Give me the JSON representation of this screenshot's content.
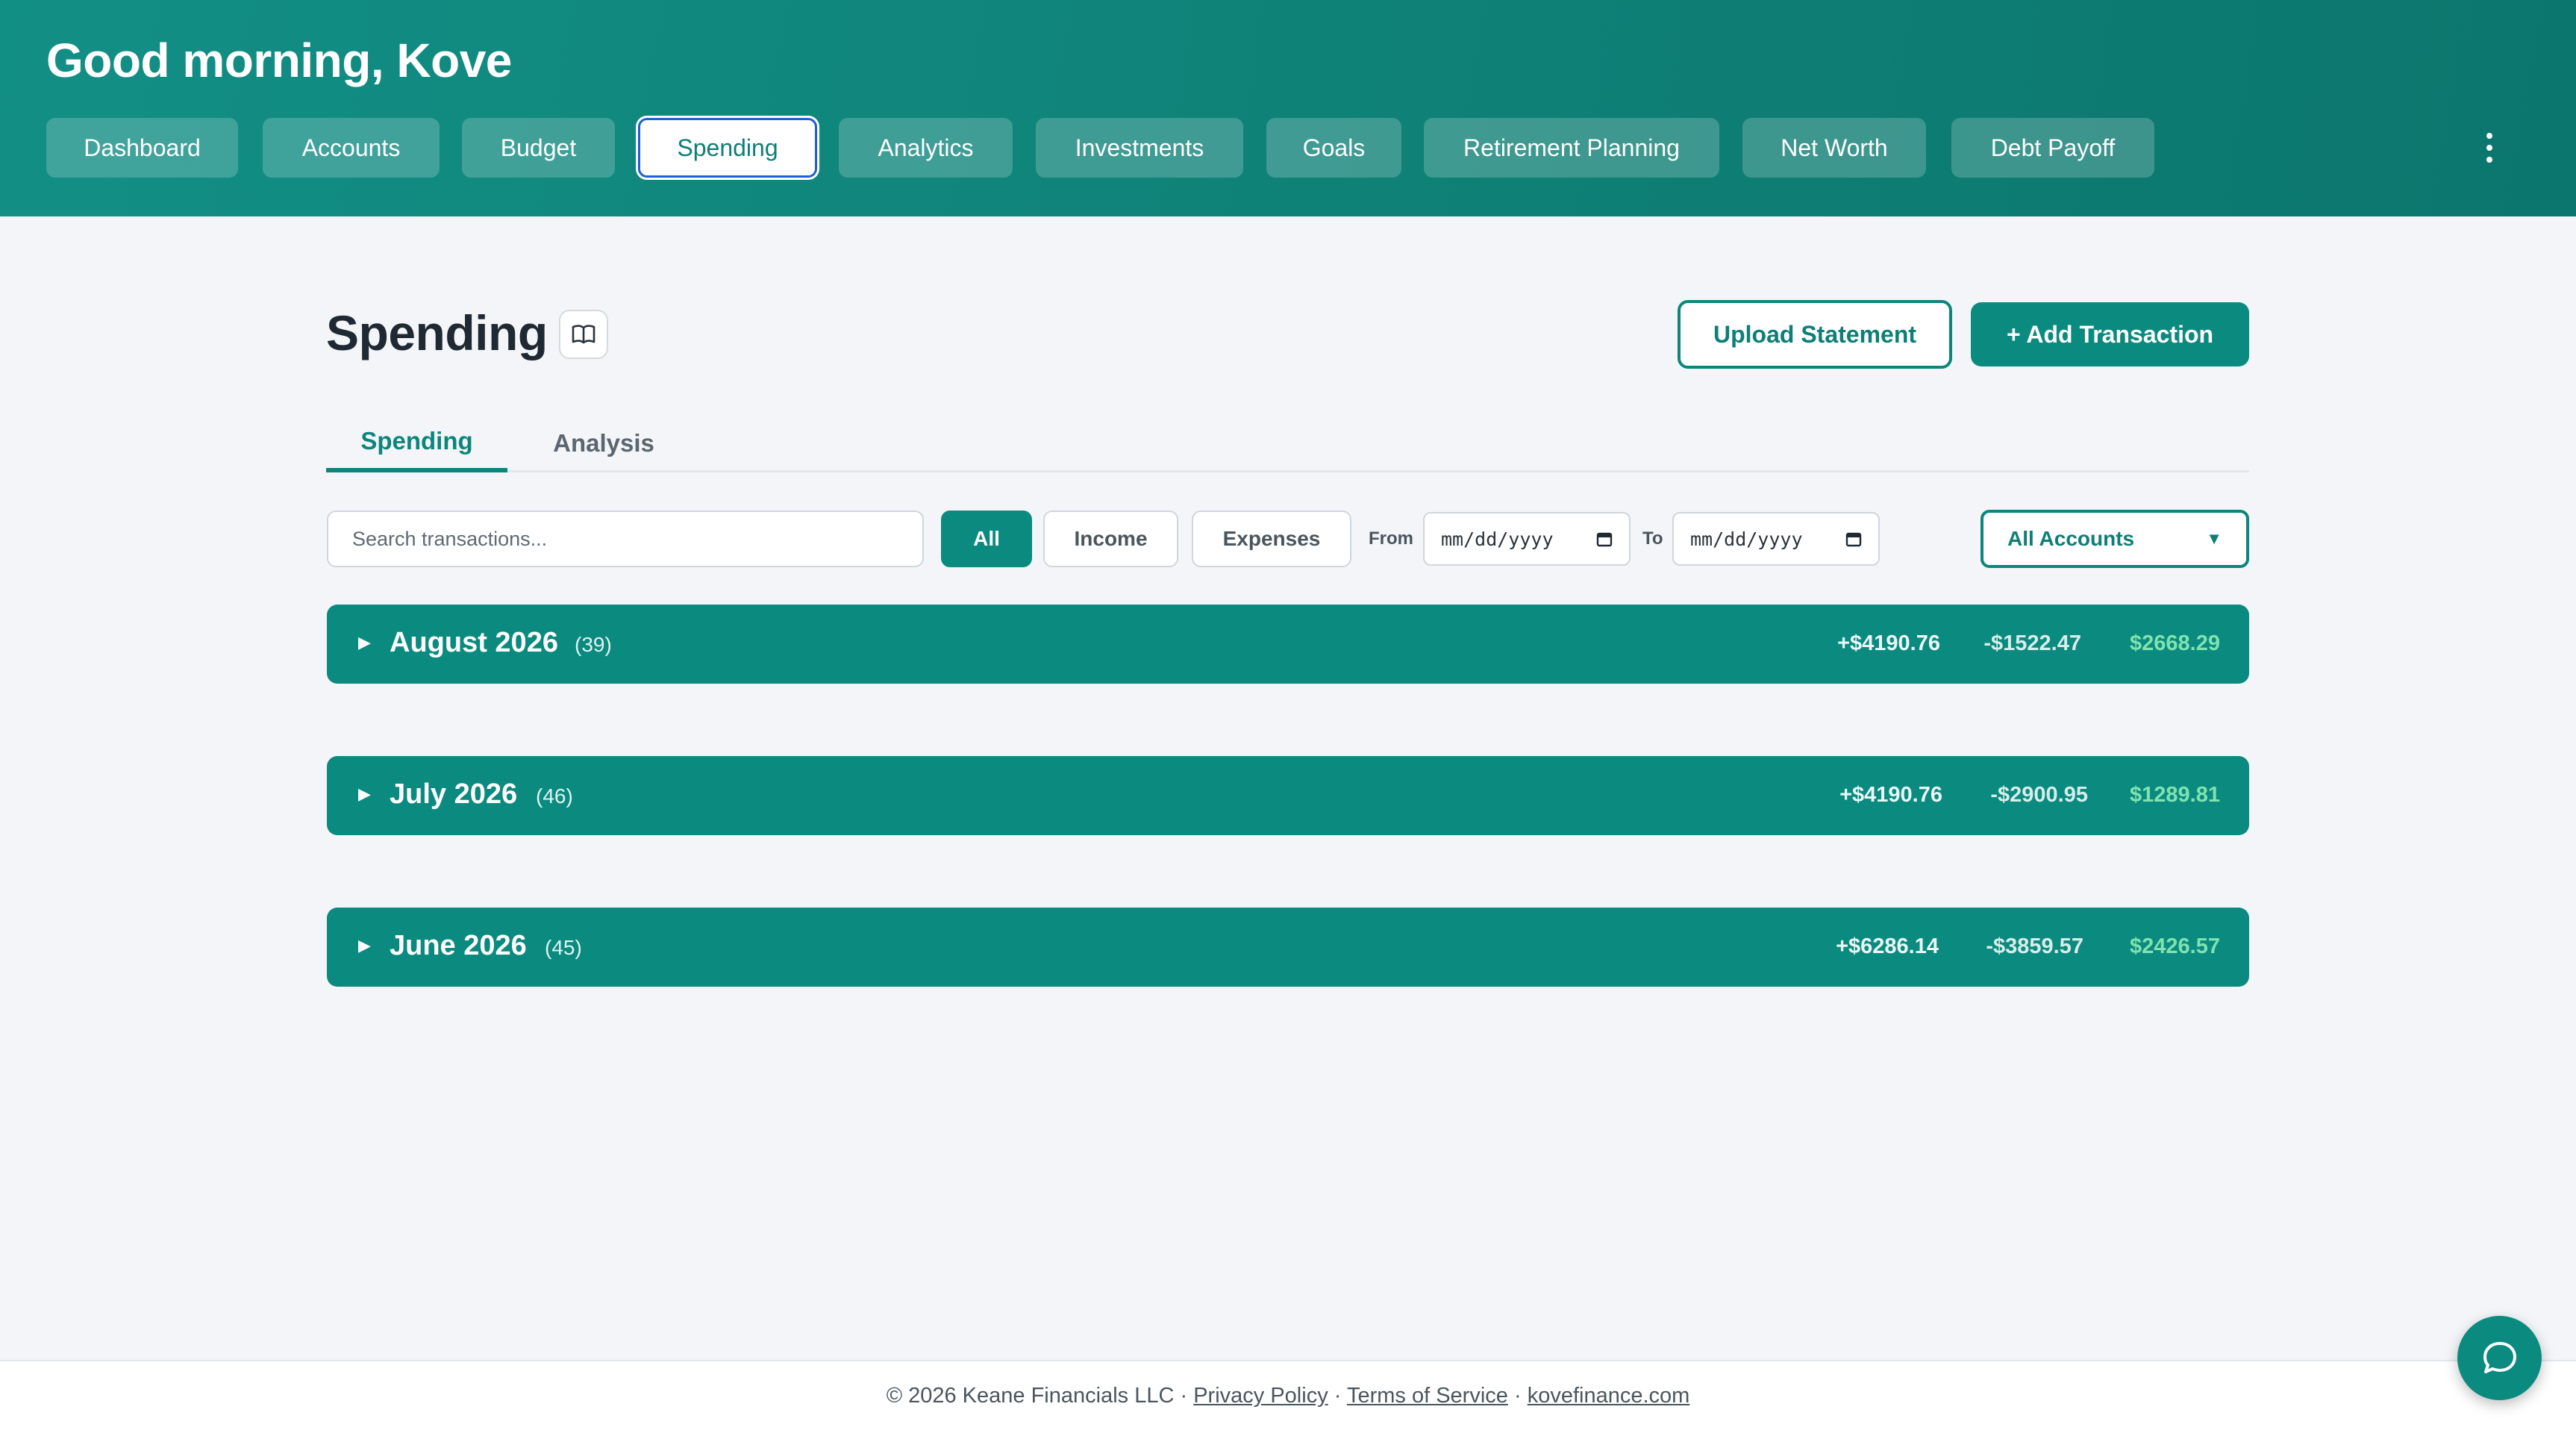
{
  "header": {
    "greeting": "Good morning, Kove",
    "nav": [
      {
        "label": "Dashboard"
      },
      {
        "label": "Accounts"
      },
      {
        "label": "Budget"
      },
      {
        "label": "Spending",
        "active": true
      },
      {
        "label": "Analytics"
      },
      {
        "label": "Investments"
      },
      {
        "label": "Goals"
      },
      {
        "label": "Retirement Planning"
      },
      {
        "label": "Net Worth"
      },
      {
        "label": "Debt Payoff"
      }
    ],
    "more_icon": "more-vertical-icon"
  },
  "page": {
    "title": "Spending",
    "guide_icon": "book-open-icon",
    "upload_label": "Upload Statement",
    "add_label": "+ Add Transaction"
  },
  "tabs": [
    {
      "label": "Spending",
      "active": true
    },
    {
      "label": "Analysis",
      "active": false
    }
  ],
  "filters": {
    "search_placeholder": "Search transactions...",
    "type_buttons": [
      {
        "label": "All",
        "selected": true
      },
      {
        "label": "Income",
        "selected": false
      },
      {
        "label": "Expenses",
        "selected": false
      }
    ],
    "from_label": "From",
    "from_value": "mm/dd/yyyy",
    "to_label": "To",
    "to_value": "mm/dd/yyyy",
    "account_select": "All Accounts"
  },
  "months": [
    {
      "name": "August 2026",
      "count": "(39)",
      "income": "+$4190.76",
      "expenses": "-$1522.47",
      "net": "$2668.29"
    },
    {
      "name": "July 2026",
      "count": "(46)",
      "income": "+$4190.76",
      "expenses": "-$2900.95",
      "net": "$1289.81"
    },
    {
      "name": "June 2026",
      "count": "(45)",
      "income": "+$6286.14",
      "expenses": "-$3859.57",
      "net": "$2426.57"
    }
  ],
  "footer": {
    "copyright": "© 2026 Keane Financials LLC",
    "sep": " · ",
    "privacy": "Privacy Policy",
    "terms": "Terms of Service",
    "site": "kovefinance.com"
  },
  "colors": {
    "brand": "#0b8a80",
    "net_positive": "#7fe3b0",
    "focus_ring": "#1f5fd0"
  }
}
